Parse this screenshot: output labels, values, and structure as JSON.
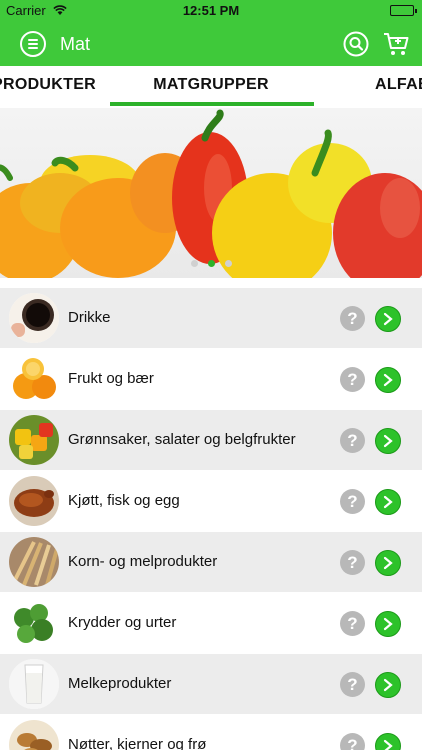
{
  "status_bar": {
    "carrier": "Carrier",
    "time": "12:51 PM"
  },
  "nav": {
    "title": "Mat",
    "menu_icon": "menu-icon",
    "search_icon": "search-icon",
    "cart_icon": "cart-icon"
  },
  "tabs": [
    {
      "label": "PRODUKTER",
      "active": false
    },
    {
      "label": "MATGRUPPER",
      "active": true
    },
    {
      "label": "ALFABETISK",
      "active": false
    }
  ],
  "banner": {
    "slide_count": 3,
    "active_slide": 2
  },
  "categories": [
    {
      "label": "Drikke",
      "icon": "coffee-icon"
    },
    {
      "label": "Frukt og bær",
      "icon": "orange-icon"
    },
    {
      "label": "Grønnsaker, salater og belgfrukter",
      "icon": "vegetables-icon"
    },
    {
      "label": "Kjøtt, fisk og egg",
      "icon": "roast-chicken-icon"
    },
    {
      "label": "Korn- og melprodukter",
      "icon": "wheat-icon"
    },
    {
      "label": "Krydder og urter",
      "icon": "herbs-icon"
    },
    {
      "label": "Melkeprodukter",
      "icon": "milk-glass-icon"
    },
    {
      "label": "Nøtter, kjerner og frø",
      "icon": "nuts-icon"
    }
  ],
  "help_label": "?",
  "colors": {
    "brand_green": "#3fc93a",
    "action_green": "#2dc22a",
    "help_gray": "#b8b8b8"
  }
}
